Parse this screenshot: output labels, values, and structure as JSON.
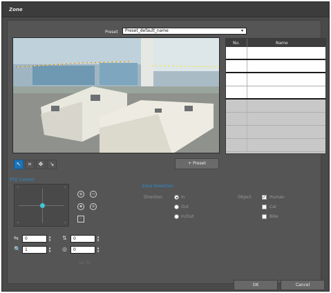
{
  "window": {
    "title": "Zone"
  },
  "preset": {
    "label": "Preset",
    "selected_value": "Preset_default_name"
  },
  "preset_table": {
    "columns": [
      "No.",
      "Name"
    ],
    "rows": [
      {
        "no": "",
        "name": ""
      },
      {
        "no": "",
        "name": ""
      },
      {
        "no": "",
        "name": ""
      },
      {
        "no": "",
        "name": ""
      },
      {
        "no": "",
        "name": ""
      },
      {
        "no": "",
        "name": ""
      },
      {
        "no": "",
        "name": ""
      },
      {
        "no": "",
        "name": ""
      }
    ]
  },
  "toolbar": {
    "tools": [
      {
        "icon": "select-arrow-icon",
        "glyph": "↖",
        "active": true
      },
      {
        "icon": "grid-icon",
        "glyph": "⌗",
        "active": false
      },
      {
        "icon": "move-icon",
        "glyph": "✥",
        "active": false
      },
      {
        "icon": "resize-icon",
        "glyph": "↘",
        "active": false
      }
    ]
  },
  "add_preset_label": "+ Preset",
  "ptz": {
    "title": "PTZ Control",
    "goto_label": "Go To",
    "fields": [
      {
        "icon": "pan-icon",
        "glyph": "⇆",
        "value": "0"
      },
      {
        "icon": "tilt-icon",
        "glyph": "⇅",
        "value": "0"
      },
      {
        "icon": "zoom-icon",
        "glyph": "🔍",
        "value": "1"
      },
      {
        "icon": "focus-icon",
        "glyph": "◎",
        "value": "0"
      }
    ]
  },
  "detection": {
    "title": "Zone Detection",
    "direction_label": "Direction",
    "direction_options": [
      {
        "label": "In",
        "checked": true
      },
      {
        "label": "Out",
        "checked": false
      },
      {
        "label": "In/Out",
        "checked": false
      }
    ],
    "object_label": "Object",
    "object_options": [
      {
        "label": "Human",
        "checked": true
      },
      {
        "label": "Car",
        "checked": false
      },
      {
        "label": "Bike",
        "checked": false
      }
    ]
  },
  "footer": {
    "ok_label": "OK",
    "cancel_label": "Cancel"
  },
  "colors": {
    "accent": "#1a74b8",
    "accent_text": "#2a8fd6",
    "panel": "#4a4a4a",
    "ptz_dot": "#3ec9d4"
  }
}
